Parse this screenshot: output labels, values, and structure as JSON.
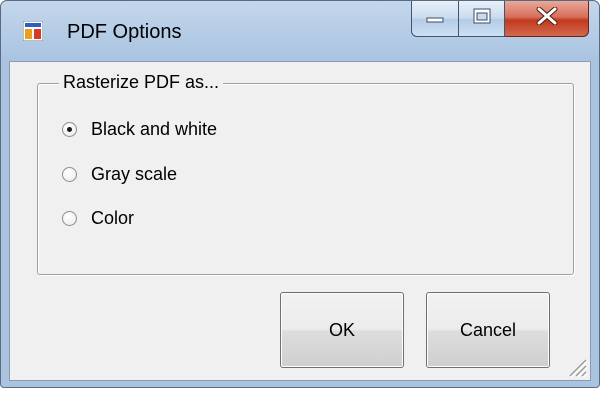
{
  "window": {
    "title": "PDF Options",
    "icon": "application-window-icon",
    "controls": {
      "minimize": "minimize-icon",
      "maximize": "maximize-icon",
      "close": "close-icon"
    }
  },
  "group": {
    "legend": "Rasterize PDF as...",
    "options": [
      {
        "label": "Black and white",
        "checked": true
      },
      {
        "label": "Gray scale",
        "checked": false
      },
      {
        "label": "Color",
        "checked": false
      }
    ]
  },
  "buttons": {
    "ok": "OK",
    "cancel": "Cancel"
  },
  "colors": {
    "title_bar": "#b6cde6",
    "close_button": "#c1391f",
    "client_background": "#f0f0f0"
  }
}
